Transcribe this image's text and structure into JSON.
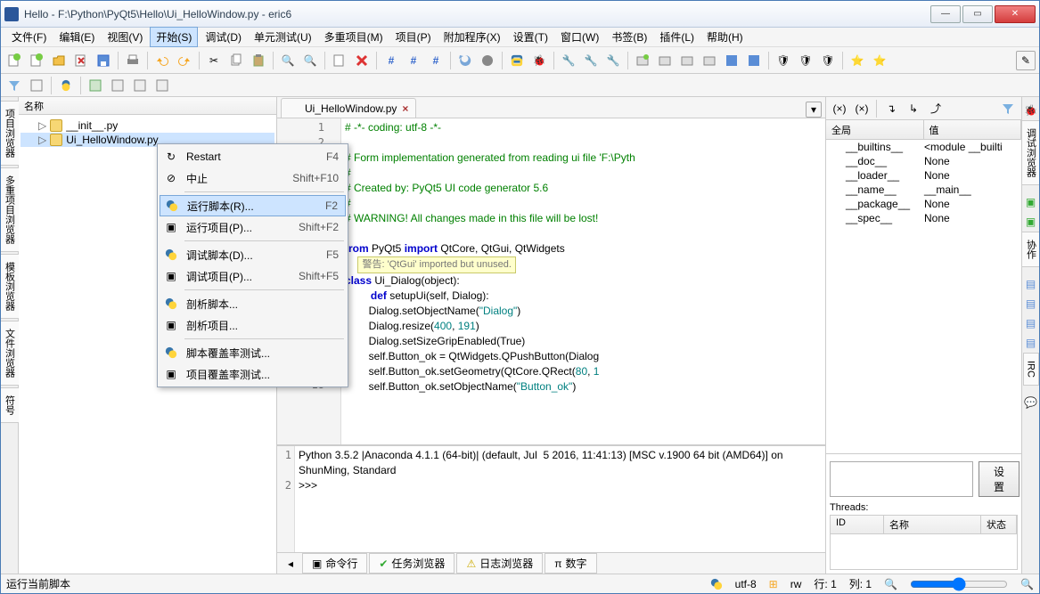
{
  "window": {
    "title": "Hello - F:\\Python\\PyQt5\\Hello\\Ui_HelloWindow.py - eric6"
  },
  "menu": {
    "file": "文件(F)",
    "edit": "编辑(E)",
    "view": "视图(V)",
    "start": "开始(S)",
    "debug": "调试(D)",
    "unit": "单元测试(U)",
    "multi": "多重项目(M)",
    "project": "项目(P)",
    "addon": "附加程序(X)",
    "settings": "设置(T)",
    "window": "窗口(W)",
    "bookmarks": "书签(B)",
    "plugins": "插件(L)",
    "help": "帮助(H)"
  },
  "dropdown": {
    "restart": {
      "label": "Restart",
      "shortcut": "F4"
    },
    "stop": {
      "label": "中止",
      "shortcut": "Shift+F10"
    },
    "run_script": {
      "label": "运行脚本(R)...",
      "shortcut": "F2"
    },
    "run_project": {
      "label": "运行项目(P)...",
      "shortcut": "Shift+F2"
    },
    "debug_script": {
      "label": "调试脚本(D)...",
      "shortcut": "F5"
    },
    "debug_project": {
      "label": "调试项目(P)...",
      "shortcut": "Shift+F5"
    },
    "profile_script": {
      "label": "剖析脚本..."
    },
    "profile_project": {
      "label": "剖析项目..."
    },
    "cov_script": {
      "label": "脚本覆盖率测试..."
    },
    "cov_project": {
      "label": "项目覆盖率测试..."
    }
  },
  "left": {
    "header": "名称",
    "items": [
      "__init__.py",
      "Ui_HelloWindow.py"
    ]
  },
  "vside": {
    "proj": "项目浏览器",
    "multi": "多重项目浏览器",
    "tmpl": "模板浏览器",
    "file": "文件浏览器",
    "sym": "符号"
  },
  "vside_r": {
    "debug": "调试浏览器",
    "coop": "协作",
    "irc": "IRC"
  },
  "tab": {
    "name": "Ui_HelloWindow.py"
  },
  "code": {
    "l1": "# -*- coding: utf-8 -*-",
    "l2": "",
    "l3": "# Form implementation generated from reading ui file 'F:\\Pyth",
    "l4": "#",
    "l5": "# Created by: PyQt5 UI code generator 5.6",
    "l6": "#",
    "l7": "# WARNING! All changes made in this file will be lost!",
    "l8": "",
    "l9a": "from",
    "l9b": " PyQt5 ",
    "l9c": "import",
    "l9d": " QtCore, QtGui, QtWidgets",
    "warn": "警告: 'QtGui' imported but unused.",
    "l11a": "class",
    "l11b": " Ui_Dialog(object):",
    "l12a": "def",
    "l12b": " setupUi(self, Dialog):",
    "l13": "        Dialog.setObjectName(",
    "l13s": "\"Dialog\"",
    "l13e": ")",
    "l14": "        Dialog.resize(",
    "l14n": "400",
    "l14c": ", ",
    "l14n2": "191",
    "l14e": ")",
    "l15": "        Dialog.setSizeGripEnabled(True)",
    "l16": "        self.Button_ok = QtWidgets.QPushButton(Dialog",
    "l17": "        self.Button_ok.setGeometry(QtCore.QRect(",
    "l17n": "80",
    "l17c": ", ",
    "l17n2": "1",
    "l18": "        self.Button_ok.setObjectName(",
    "l18s": "\"Button_ok\"",
    "l18e": ")"
  },
  "console": {
    "l1a": "Python ",
    "l1b": "3.5.2",
    "l1c": " |Anaconda 4.1.1 (",
    "l1d": "64",
    "l1e": "-bit)| (default, Jul  5 2016, ",
    "l1f": "11",
    "l2a": ":",
    "l2b": "41",
    "l2c": ":",
    "l2d": "13",
    "l2e": ") [MSC v.",
    "l2f": "1900 64",
    "l2g": " bit (AMD64)] on ShunMing, Standard",
    "l3": ">>> "
  },
  "btabs": {
    "cmd": "命令行",
    "task": "任务浏览器",
    "log": "日志浏览器",
    "num": "数字"
  },
  "right": {
    "h1": "全局",
    "h2": "值",
    "rows": [
      {
        "k": "__builtins__",
        "v": "<module __builti"
      },
      {
        "k": "__doc__",
        "v": "None"
      },
      {
        "k": "__loader__",
        "v": "None"
      },
      {
        "k": "__name__",
        "v": "__main__"
      },
      {
        "k": "__package__",
        "v": "None"
      },
      {
        "k": "__spec__",
        "v": "None"
      }
    ],
    "setbtn": "设置",
    "threads": "Threads:",
    "tid": "ID",
    "tname": "名称",
    "tstate": "状态"
  },
  "status": {
    "left": "运行当前脚本",
    "enc": "utf-8",
    "rw": "rw",
    "line": "行: 1",
    "col": "列: 1"
  }
}
